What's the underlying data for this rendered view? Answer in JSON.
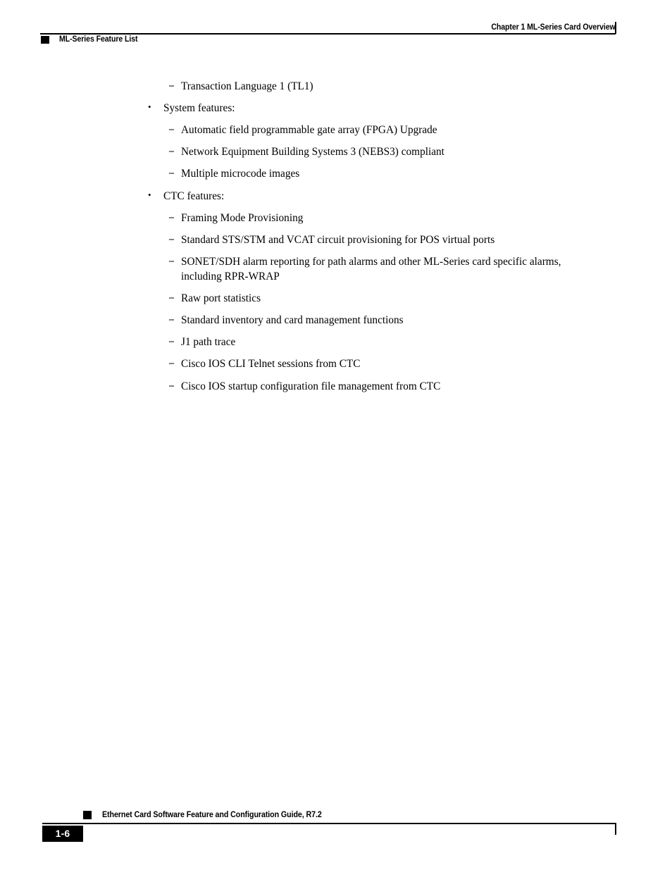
{
  "header": {
    "chapter": "Chapter 1 ML-Series Card Overview",
    "section": "ML-Series Feature List",
    "marker_icon": "black-square-marker"
  },
  "body": {
    "blocks": [
      {
        "type": "dash",
        "marker": "–",
        "text": "Transaction Language 1 (TL1)"
      },
      {
        "type": "bullet",
        "marker": "•",
        "text": "System features:"
      },
      {
        "type": "dash",
        "marker": "–",
        "text": "Automatic field programmable gate array (FPGA) Upgrade"
      },
      {
        "type": "dash",
        "marker": "–",
        "text": "Network Equipment Building Systems 3 (NEBS3) compliant"
      },
      {
        "type": "dash",
        "marker": "–",
        "text": "Multiple microcode images"
      },
      {
        "type": "bullet",
        "marker": "•",
        "text": "CTC features:"
      },
      {
        "type": "dash",
        "marker": "–",
        "text": "Framing Mode Provisioning"
      },
      {
        "type": "dash",
        "marker": "–",
        "text": "Standard STS/STM and VCAT circuit provisioning for POS virtual ports"
      },
      {
        "type": "dash",
        "marker": "–",
        "text": "SONET/SDH alarm reporting for path alarms and other ML-Series card specific alarms, including RPR-WRAP"
      },
      {
        "type": "dash",
        "marker": "–",
        "text": "Raw port statistics"
      },
      {
        "type": "dash",
        "marker": "–",
        "text": "Standard inventory and card management functions"
      },
      {
        "type": "dash",
        "marker": "–",
        "text": "J1 path trace"
      },
      {
        "type": "dash",
        "marker": "–",
        "text": "Cisco IOS CLI Telnet sessions from CTC"
      },
      {
        "type": "dash",
        "marker": "–",
        "text": "Cisco IOS startup configuration file management from CTC"
      }
    ]
  },
  "footer": {
    "guide_title": "Ethernet Card Software Feature and Configuration Guide, R7.2",
    "page_number": "1-6",
    "marker_icon": "black-square-marker"
  }
}
